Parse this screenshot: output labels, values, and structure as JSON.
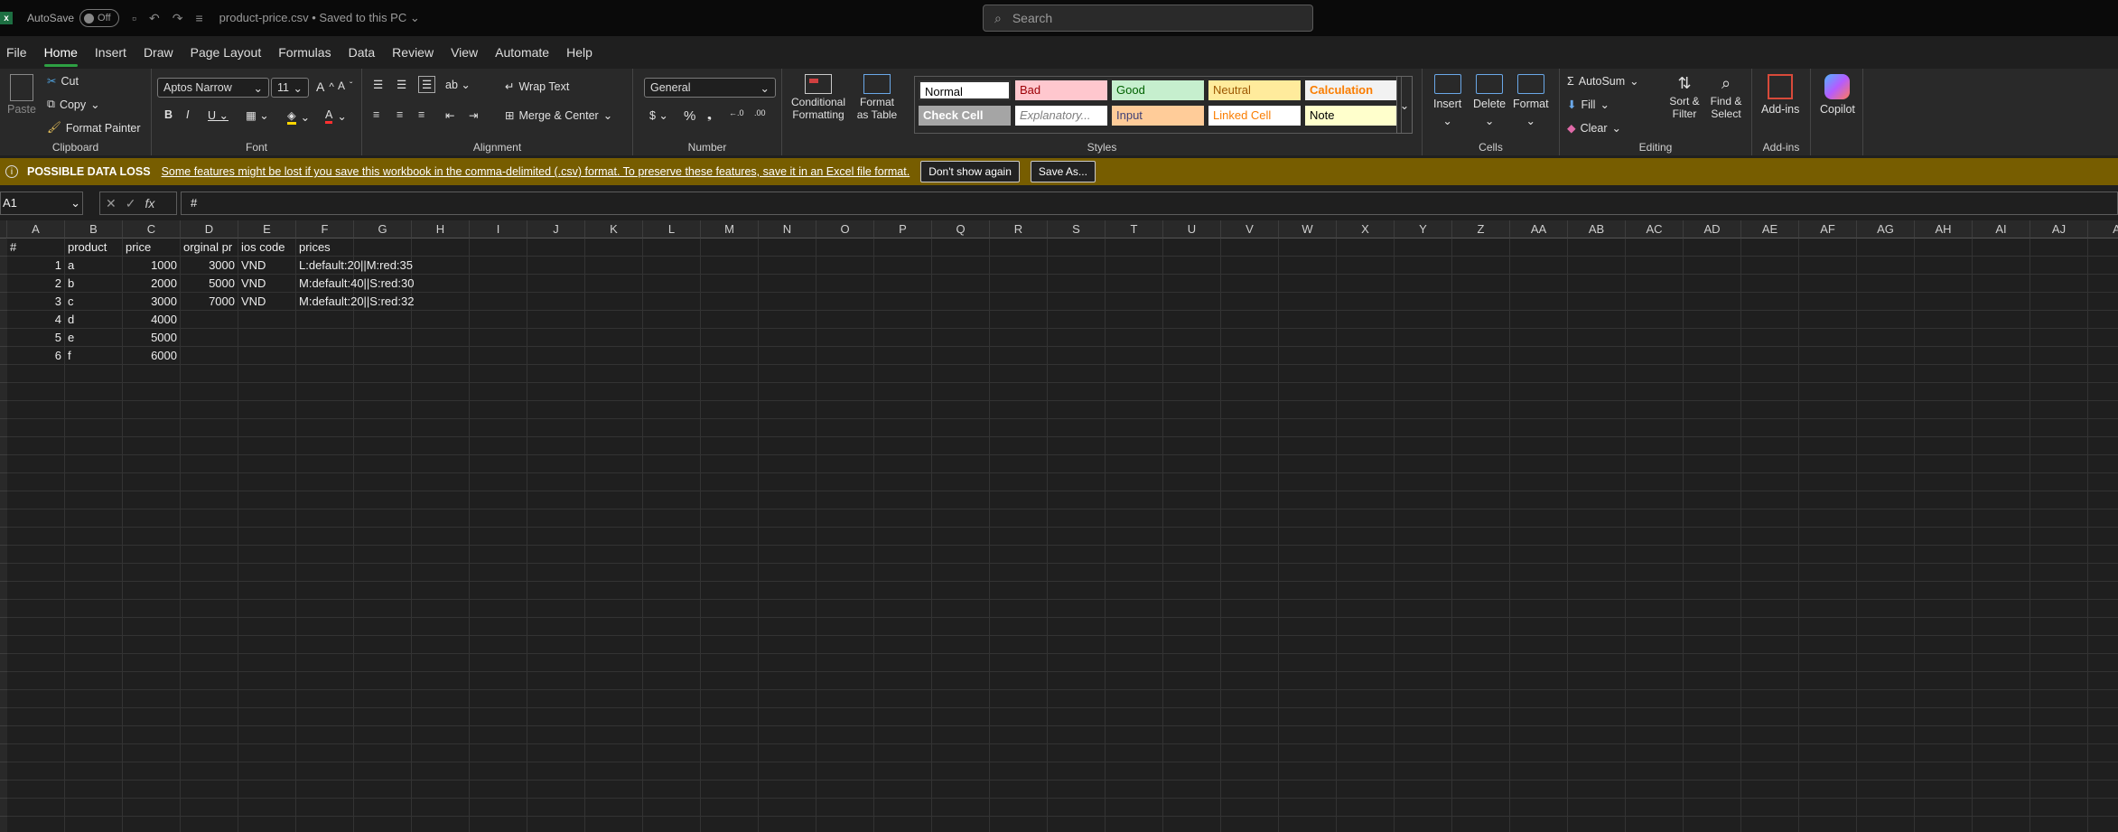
{
  "titlebar": {
    "autosave_label": "AutoSave",
    "autosave_state": "Off",
    "filename": "product-price.csv  •  Saved to this PC ⌄",
    "search_placeholder": "Search"
  },
  "menu": [
    "File",
    "Home",
    "Insert",
    "Draw",
    "Page Layout",
    "Formulas",
    "Data",
    "Review",
    "View",
    "Automate",
    "Help"
  ],
  "active_menu": "Home",
  "ribbon": {
    "clipboard": {
      "paste": "Paste",
      "cut": "Cut",
      "copy": "Copy",
      "format_painter": "Format Painter",
      "label": "Clipboard"
    },
    "font": {
      "family": "Aptos Narrow",
      "size": "11",
      "label": "Font"
    },
    "alignment": {
      "wrap": "Wrap Text",
      "merge": "Merge & Center",
      "label": "Alignment"
    },
    "number": {
      "format": "General",
      "label": "Number"
    },
    "styles": {
      "conditional": "Conditional Formatting",
      "format_table": "Format as Table",
      "label": "Styles",
      "cells": [
        {
          "text": "Normal",
          "bg": "#ffffff",
          "fg": "#000000"
        },
        {
          "text": "Bad",
          "bg": "#ffc7ce",
          "fg": "#9c0006"
        },
        {
          "text": "Good",
          "bg": "#c6efce",
          "fg": "#006100"
        },
        {
          "text": "Neutral",
          "bg": "#ffeb9c",
          "fg": "#9c5700"
        },
        {
          "text": "Calculation",
          "bg": "#f2f2f2",
          "fg": "#fa7d00"
        },
        {
          "text": "Check Cell",
          "bg": "#a5a5a5",
          "fg": "#ffffff"
        },
        {
          "text": "Explanatory...",
          "bg": "#ffffff",
          "fg": "#7f7f7f"
        },
        {
          "text": "Input",
          "bg": "#ffcc99",
          "fg": "#3f3f76"
        },
        {
          "text": "Linked Cell",
          "bg": "#ffffff",
          "fg": "#fa7d00"
        },
        {
          "text": "Note",
          "bg": "#ffffcc",
          "fg": "#000000"
        }
      ]
    },
    "cells": {
      "insert": "Insert",
      "delete": "Delete",
      "format": "Format",
      "label": "Cells"
    },
    "editing": {
      "autosum": "AutoSum",
      "fill": "Fill",
      "clear": "Clear",
      "sort": "Sort & Filter",
      "find": "Find & Select",
      "label": "Editing"
    },
    "addins": {
      "addins": "Add-ins",
      "label": "Add-ins"
    },
    "copilot": {
      "label": "Copilot"
    }
  },
  "warning": {
    "title": "POSSIBLE DATA LOSS",
    "message": "Some features might be lost if you save this workbook in the comma-delimited (.csv) format. To preserve these features, save it in an Excel file format.",
    "btn_dont_show": "Don't show again",
    "btn_save_as": "Save As..."
  },
  "formula_bar": {
    "namebox": "A1",
    "fx": "fx",
    "formula": "#"
  },
  "columns": [
    "A",
    "B",
    "C",
    "D",
    "E",
    "F",
    "G",
    "H",
    "I",
    "J",
    "K",
    "L",
    "M",
    "N",
    "O",
    "P",
    "Q",
    "R",
    "S",
    "T",
    "U",
    "V",
    "W",
    "X",
    "Y",
    "Z",
    "AA",
    "AB",
    "AC",
    "AD",
    "AE",
    "AF",
    "AG",
    "AH",
    "AI",
    "AJ",
    "A"
  ],
  "sheet": {
    "header": [
      "#",
      "product",
      "price",
      "orginal pr",
      "ios code",
      "prices"
    ],
    "rows": [
      [
        "1",
        "a",
        "1000",
        "3000",
        "VND",
        "L:default:20||M:red:35"
      ],
      [
        "2",
        "b",
        "2000",
        "5000",
        "VND",
        "M:default:40||S:red:30"
      ],
      [
        "3",
        "c",
        "3000",
        "7000",
        "VND",
        "M:default:20||S:red:32"
      ],
      [
        "4",
        "d",
        "4000",
        "",
        "",
        ""
      ],
      [
        "5",
        "e",
        "5000",
        "",
        "",
        ""
      ],
      [
        "6",
        "f",
        "6000",
        "",
        "",
        ""
      ]
    ]
  }
}
